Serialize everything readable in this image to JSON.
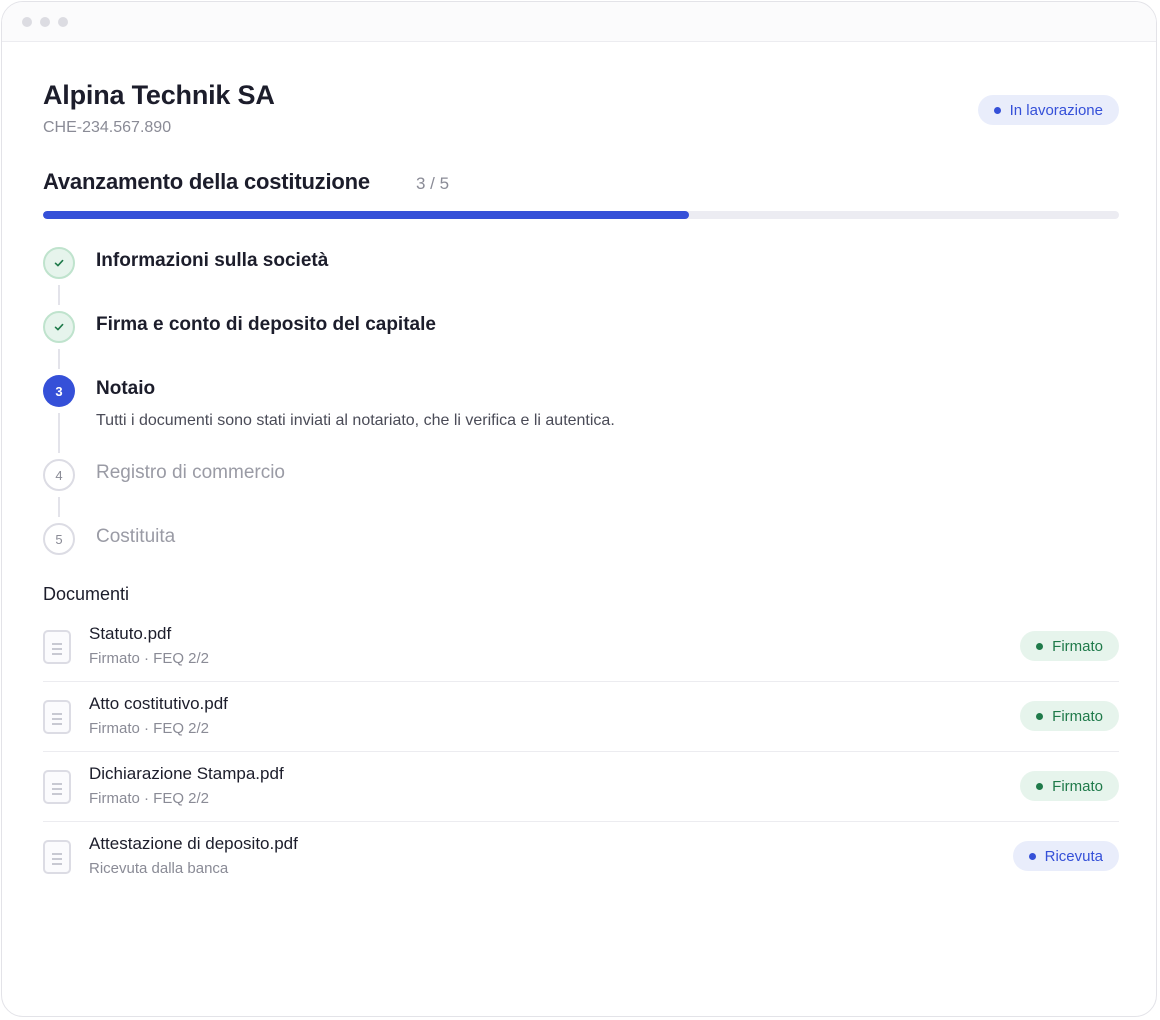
{
  "company": {
    "name": "Alpina Technik SA",
    "uid": "CHE-234.567.890",
    "status": "In lavorazione",
    "status_color": "#3550d8"
  },
  "progress": {
    "title": "Avanzamento della costituzione",
    "count": "3 / 5",
    "current": 3,
    "total": 5,
    "fraction": 0.6,
    "color": "#3550d8"
  },
  "steps": [
    {
      "label": "Informazioni sulla società",
      "state": "done",
      "number": "1",
      "icon": "check-icon"
    },
    {
      "label": "Firma e conto di deposito del capitale",
      "state": "done",
      "number": "2",
      "icon": "check-icon"
    },
    {
      "label": "Notaio",
      "state": "current",
      "number": "3",
      "description": "Tutti i documenti sono stati inviati al notariato, che li verifica e li autentica."
    },
    {
      "label": "Registro di commercio",
      "state": "todo",
      "number": "4"
    },
    {
      "label": "Costituita",
      "state": "todo",
      "number": "5"
    }
  ],
  "documents": {
    "title": "Documenti",
    "items": [
      {
        "name": "Statuto.pdf",
        "sub": "Firmato · FEQ 2/2",
        "badge": "Firmato",
        "badge_type": "signed",
        "icon": "document-icon"
      },
      {
        "name": "Atto costitutivo.pdf",
        "sub": "Firmato · FEQ 2/2",
        "badge": "Firmato",
        "badge_type": "signed",
        "icon": "document-icon"
      },
      {
        "name": "Dichiarazione Stampa.pdf",
        "sub": "Firmato · FEQ 2/2",
        "badge": "Firmato",
        "badge_type": "signed",
        "icon": "document-icon"
      },
      {
        "name": "Attestazione di deposito.pdf",
        "sub": "Ricevuta dalla banca",
        "badge": "Ricevuta",
        "badge_type": "received",
        "icon": "document-icon"
      }
    ]
  },
  "colors": {
    "signed": "#1f7a4a",
    "signed_bg": "#e6f4ec",
    "received": "#3550d8",
    "received_bg": "#e9edfb"
  }
}
